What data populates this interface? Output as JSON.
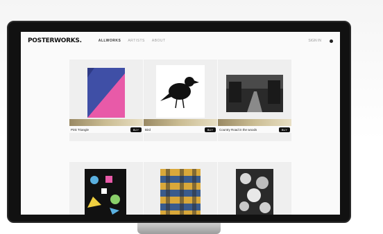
{
  "site": {
    "logo": "POSTERWORKS.",
    "nav": [
      "ALLWORKS",
      "ARTISTS",
      "ABOUT"
    ],
    "signin": "SIGN IN"
  },
  "products_row1": [
    {
      "title": "Pink Triangle",
      "cta": "BUY"
    },
    {
      "title": "Bird",
      "cta": "BUY"
    },
    {
      "title": "Country Road in the woods",
      "cta": "BUY"
    }
  ],
  "colors": {
    "accent": "#111111",
    "poster1_blue": "#3f4fa6",
    "poster1_pink": "#e85aa8",
    "gold_strip": "#cbbd93"
  }
}
